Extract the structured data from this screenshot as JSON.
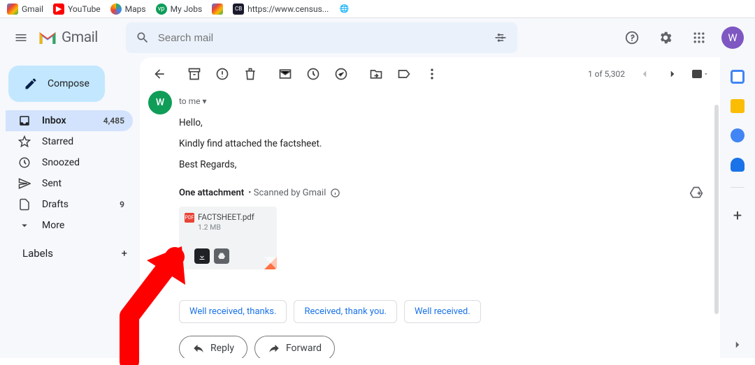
{
  "bookmarks": [
    {
      "label": "Gmail",
      "color": "#ea4335"
    },
    {
      "label": "YouTube",
      "color": "#ff0000"
    },
    {
      "label": "Maps",
      "color": "#34a853"
    },
    {
      "label": "My Jobs",
      "color": "#0f9d58"
    },
    {
      "label": "",
      "color": "#ea4335"
    },
    {
      "label": "https://www.census...",
      "color": "#202124"
    },
    {
      "label": "",
      "color": "#5f6368"
    }
  ],
  "app": {
    "name": "Gmail"
  },
  "search": {
    "placeholder": "Search mail"
  },
  "avatar": {
    "initial": "W"
  },
  "compose": {
    "label": "Compose"
  },
  "sidebar": {
    "items": [
      {
        "icon": "inbox",
        "label": "Inbox",
        "count": "4,485",
        "active": true
      },
      {
        "icon": "star",
        "label": "Starred"
      },
      {
        "icon": "clock",
        "label": "Snoozed"
      },
      {
        "icon": "send",
        "label": "Sent"
      },
      {
        "icon": "draft",
        "label": "Drafts",
        "count": "9"
      },
      {
        "icon": "more",
        "label": "More"
      }
    ],
    "labels_title": "Labels"
  },
  "toolbar": {
    "count": "1 of 5,302"
  },
  "message": {
    "sender_initial": "W",
    "to": "to me",
    "body_lines": [
      "Hello,",
      "Kindly find attached the factsheet.",
      "Best Regards,"
    ],
    "attachment_header": "One attachment",
    "scanned": " • Scanned by Gmail",
    "attachment": {
      "name": "FACTSHEET.pdf",
      "size": "1.2 MB"
    },
    "smart_replies": [
      "Well received, thanks.",
      "Received, thank you.",
      "Well received."
    ],
    "reply": "Reply",
    "forward": "Forward"
  }
}
